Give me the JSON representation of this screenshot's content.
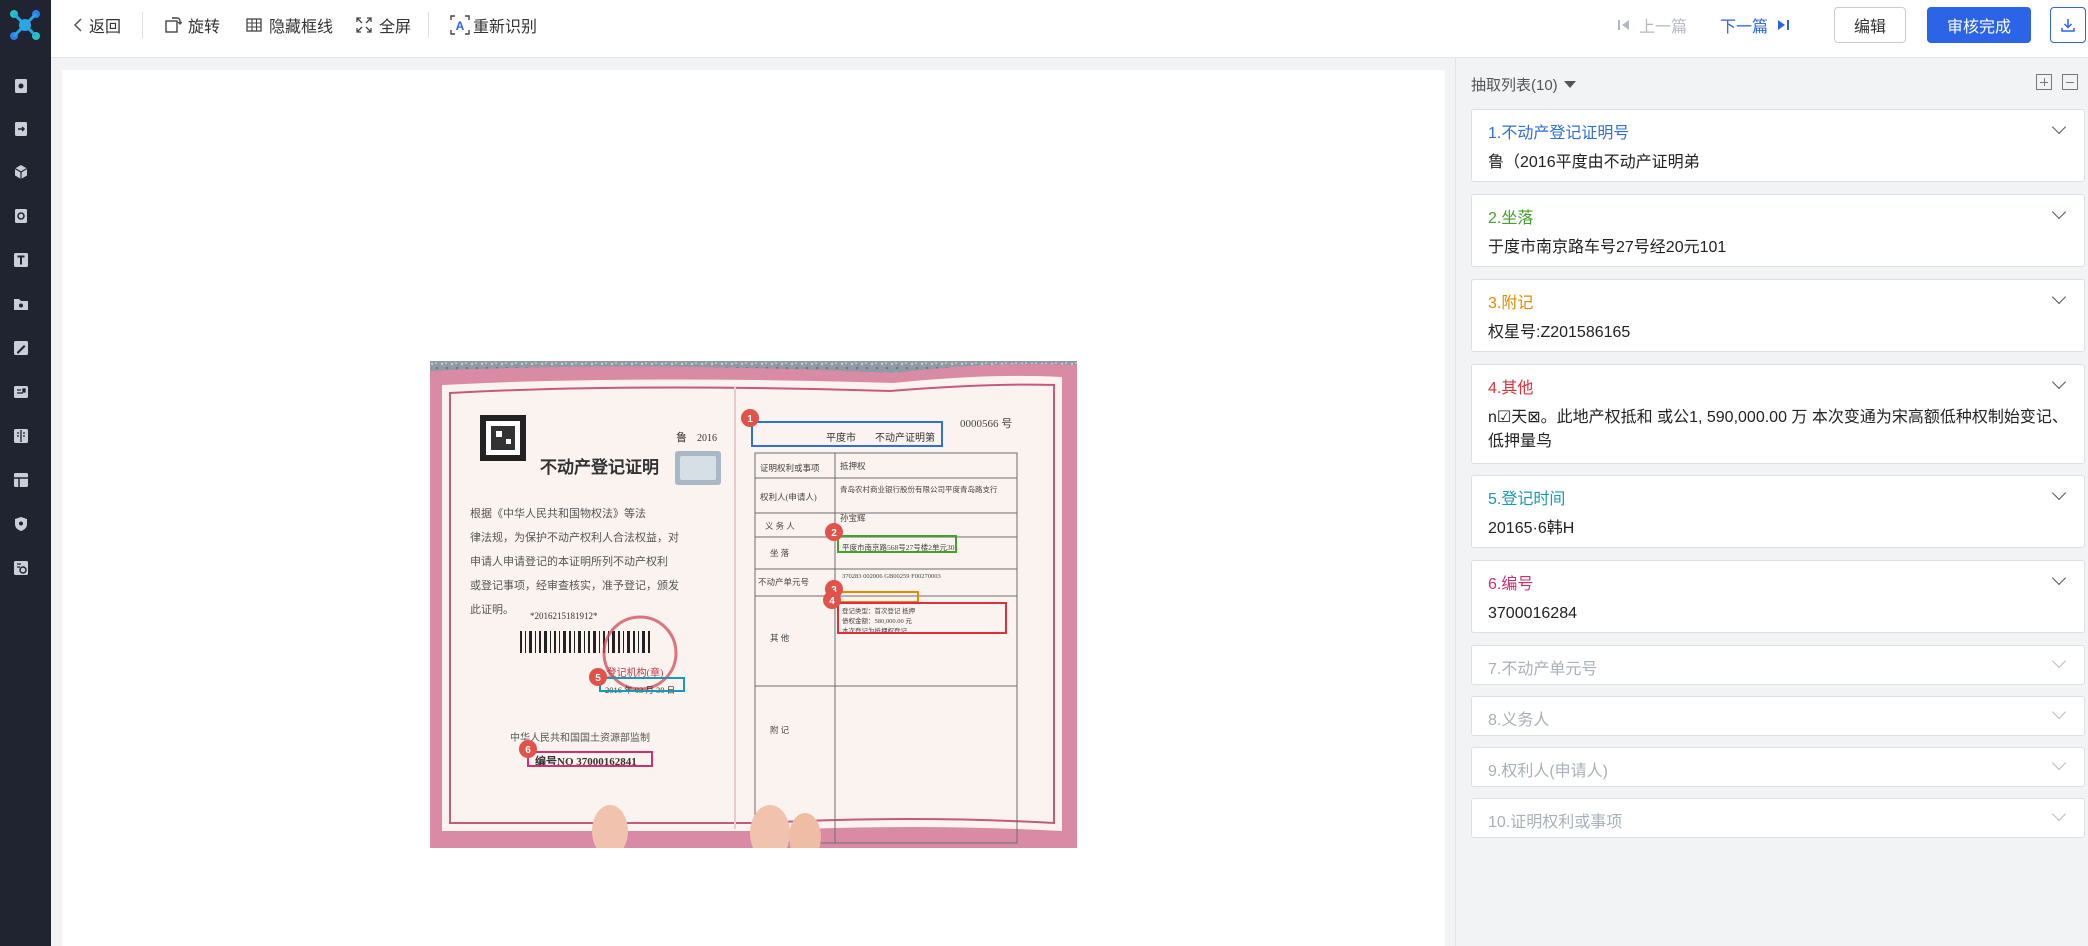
{
  "toolbar": {
    "back": "返回",
    "rotate": "旋转",
    "hide_lines": "隐藏框线",
    "fullscreen": "全屏",
    "rerecognize": "重新识别",
    "prev": "上一篇",
    "next": "下一篇",
    "edit": "编辑",
    "approve": "审核完成"
  },
  "rail": {
    "icons": [
      "doc-icon",
      "doc-export-icon",
      "cube-icon",
      "shield-doc-icon",
      "text-icon",
      "folder-icon",
      "edit-icon",
      "id-card-icon",
      "book-icon",
      "table-icon",
      "shield-icon",
      "settings-icon"
    ]
  },
  "certificate": {
    "title": "不动产登记证明",
    "prefix": "鲁",
    "year": "2016",
    "city": "平度市",
    "suffix": "不动产证明第",
    "number_top": "0000566 号",
    "rows": [
      {
        "label": "证明权利或事项",
        "value": "抵押权"
      },
      {
        "label": "权利人(申请人)",
        "value": "青岛农村商业银行股份有限公司平度青岛路支行"
      },
      {
        "label": "义 务 人",
        "value": "孙宝辉"
      },
      {
        "label": "坐  落",
        "value": "平度市南京路568号27号楼2单元301"
      },
      {
        "label": "不动产单元号",
        "value": "370283 002006 GB00259 F00270003"
      },
      {
        "label": "其  他",
        "value": "登记类型：首次登记 抵押类型：一般抵押 债权金额：580,000.00 元 本次登记为抵押权"
      },
      {
        "label": "附  记",
        "value": ""
      }
    ],
    "body_text": "根据《中华人民共和国物权法》等法律法规，为保护不动产权利人合法权益，对申请人申请登记的本证明所列不动产权利或登记事项，经审查核实，准予登记，颁发此证明。",
    "barcode": "*2016215181912*",
    "seal": "登记机构(章)",
    "date": "2016 年 03 月 30 日",
    "issuer": "中华人民共和国国土资源部监制",
    "serial": "编号NO 37000162841",
    "markers": [
      "1",
      "2",
      "3",
      "4",
      "5",
      "6"
    ]
  },
  "panel": {
    "header": "抽取列表(10)",
    "items": [
      {
        "title": "1.不动产登记证明号",
        "value": "鲁（2016平度由不动产证明弟",
        "color": "#2f6fd6",
        "collapsed": false
      },
      {
        "title": "2.坐落",
        "value": "于度市南京路车号27号经20元101",
        "color": "#43a02a",
        "collapsed": false
      },
      {
        "title": "3.附记",
        "value": "权星号:Z201586165",
        "color": "#e58a00",
        "collapsed": false
      },
      {
        "title": "4.其他",
        "value": "n☑天⊠。此地产权抵和 或公1, 590,000.00 万 本次变通为宋高额低种权制始变记、低押量鸟",
        "color": "#e02f3a",
        "collapsed": false
      },
      {
        "title": "5.登记时间",
        "value": "20165·6韩H",
        "color": "#1a9ab0",
        "collapsed": false
      },
      {
        "title": "6.编号",
        "value": "3700016284",
        "color": "#d12f6e",
        "collapsed": false
      },
      {
        "title": "7.不动产单元号",
        "value": "",
        "color": "#aab0b8",
        "collapsed": true
      },
      {
        "title": "8.义务人",
        "value": "",
        "color": "#aab0b8",
        "collapsed": true
      },
      {
        "title": "9.权利人(申请人)",
        "value": "",
        "color": "#aab0b8",
        "collapsed": true
      },
      {
        "title": "10.证明权利或事项",
        "value": "",
        "color": "#aab0b8",
        "collapsed": true
      }
    ]
  }
}
